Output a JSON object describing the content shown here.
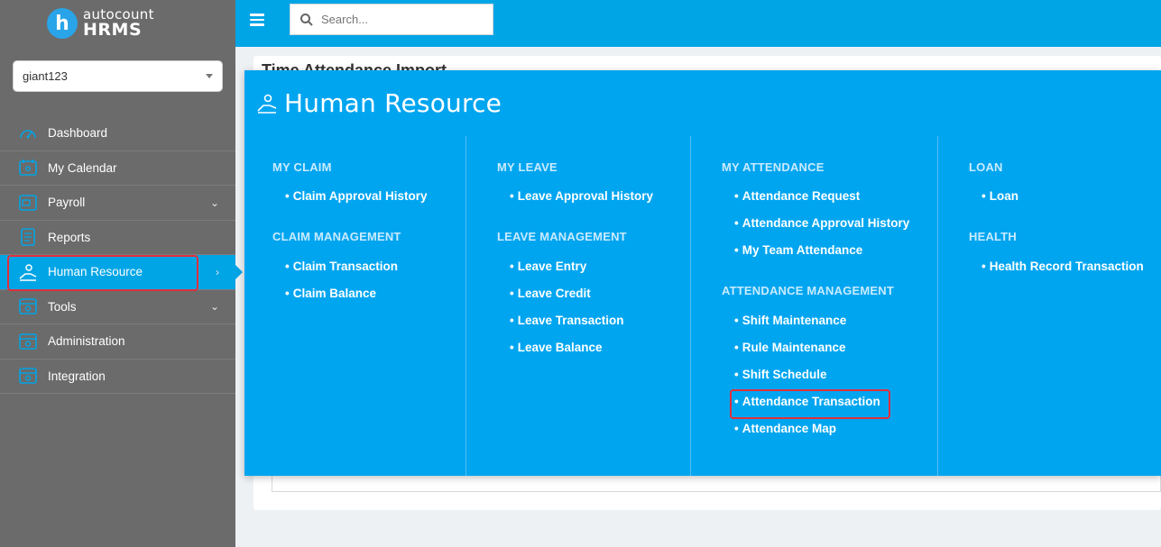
{
  "brand": {
    "badge": "h",
    "line1": "autocount",
    "line2": "HRMS"
  },
  "company": {
    "selected": "giant123"
  },
  "search": {
    "placeholder": "Search..."
  },
  "sidebar": {
    "items": [
      {
        "label": "Dashboard",
        "icon": "gauge-icon"
      },
      {
        "label": "My Calendar",
        "icon": "calendar-icon"
      },
      {
        "label": "Payroll",
        "icon": "payroll-icon",
        "chevron": "down"
      },
      {
        "label": "Reports",
        "icon": "report-icon"
      },
      {
        "label": "Human Resource",
        "icon": "human-resource-icon",
        "chevron": "right",
        "active": true
      },
      {
        "label": "Tools",
        "icon": "tools-icon",
        "chevron": "down"
      },
      {
        "label": "Administration",
        "icon": "admin-icon"
      },
      {
        "label": "Integration",
        "icon": "integration-icon"
      }
    ]
  },
  "page": {
    "title_partial": "Time Attendance Import"
  },
  "mega_menu": {
    "title": "Human Resource",
    "columns": [
      {
        "sections": [
          {
            "title": "MY CLAIM",
            "links": [
              "Claim Approval History"
            ]
          },
          {
            "title": "CLAIM MANAGEMENT",
            "links": [
              "Claim Transaction",
              "Claim Balance"
            ]
          }
        ]
      },
      {
        "sections": [
          {
            "title": "MY LEAVE",
            "links": [
              "Leave Approval History"
            ]
          },
          {
            "title": "LEAVE MANAGEMENT",
            "links": [
              "Leave Entry",
              "Leave Credit",
              "Leave Transaction",
              "Leave Balance"
            ]
          }
        ]
      },
      {
        "sections": [
          {
            "title": "MY ATTENDANCE",
            "links": [
              "Attendance Request",
              "Attendance Approval History",
              "My Team Attendance"
            ]
          },
          {
            "title": "ATTENDANCE MANAGEMENT",
            "links": [
              "Shift Maintenance",
              "Rule Maintenance",
              "Shift Schedule",
              "Attendance Transaction",
              "Attendance Map"
            ]
          }
        ]
      },
      {
        "sections": [
          {
            "title": "LOAN",
            "links": [
              "Loan"
            ]
          },
          {
            "title": "HEALTH",
            "links": [
              "Health Record Transaction"
            ]
          }
        ]
      }
    ]
  },
  "colors": {
    "accent": "#00a5e6",
    "menu_bg": "#00a5f0",
    "sidebar_bg": "#6b6b6b",
    "highlight": "#e0303b"
  }
}
